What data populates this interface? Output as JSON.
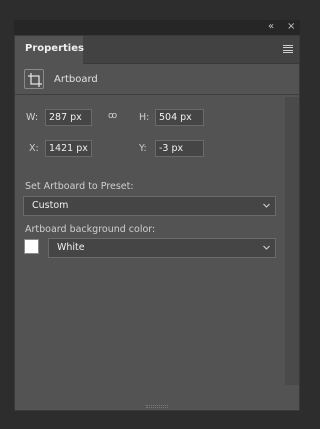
{
  "window": {
    "collapse_glyph": "«",
    "close_glyph": "×"
  },
  "panel": {
    "tab_label": "Properties",
    "menu_icon": "hamburger-icon",
    "section_icon": "artboard-icon",
    "section_label": "Artboard"
  },
  "dimensions": {
    "w_label": "W:",
    "w_value": "287 px",
    "link_icon": "ꝏ",
    "h_label": "H:",
    "h_value": "504 px",
    "x_label": "X:",
    "x_value": "1421 px",
    "y_label": "Y:",
    "y_value": "-3 px"
  },
  "preset": {
    "label": "Set Artboard to Preset:",
    "value": "Custom"
  },
  "background": {
    "label": "Artboard background color:",
    "swatch_color": "#ffffff",
    "value": "White"
  }
}
